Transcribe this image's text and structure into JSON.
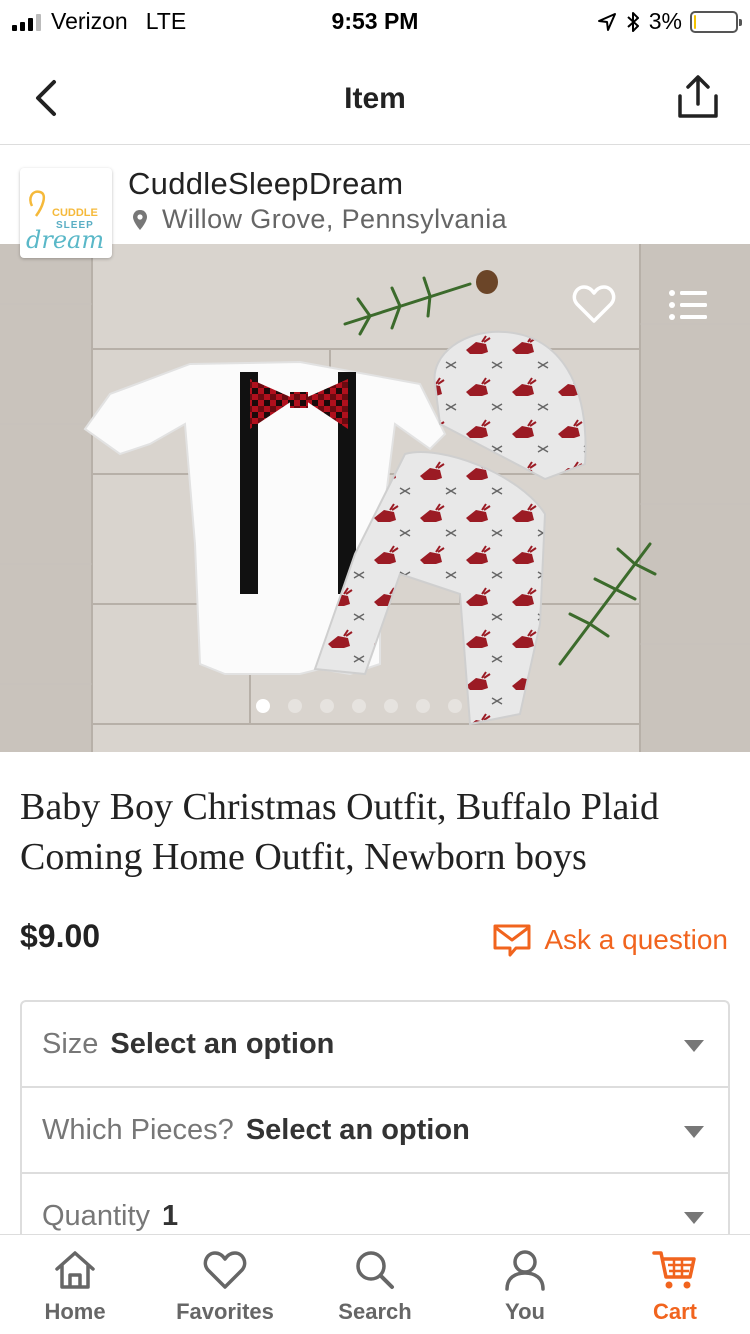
{
  "status_bar": {
    "carrier": "Verizon",
    "network": "LTE",
    "time": "9:53 PM",
    "battery": "3%",
    "battery_level": 0.03
  },
  "header": {
    "title": "Item",
    "back_icon": "chevron-left-icon",
    "share_icon": "share-icon"
  },
  "shop": {
    "name": "CuddleSleepDream",
    "location": "Willow Grove, Pennsylvania",
    "logo_text": [
      "CUDDLE",
      "SLEEP",
      "dream"
    ]
  },
  "gallery": {
    "image_count": 7,
    "current_index": 0
  },
  "product": {
    "title": "Baby Boy Christmas Outfit, Buffalo Plaid Coming Home Outfit, Newborn boys",
    "price": "$9.00",
    "ask_label": "Ask a question"
  },
  "options": [
    {
      "label": "Size",
      "value": "Select an option"
    },
    {
      "label": "Which Pieces?",
      "value": "Select an option"
    },
    {
      "label": "Quantity",
      "value": "1"
    }
  ],
  "tabs": [
    {
      "label": "Home",
      "icon": "home-icon"
    },
    {
      "label": "Favorites",
      "icon": "heart-icon"
    },
    {
      "label": "Search",
      "icon": "search-icon"
    },
    {
      "label": "You",
      "icon": "user-icon"
    },
    {
      "label": "Cart",
      "icon": "cart-icon",
      "active": true
    }
  ],
  "colors": {
    "accent": "#f1641e",
    "text": "#222222",
    "muted": "#666666",
    "border": "#dddddd"
  }
}
